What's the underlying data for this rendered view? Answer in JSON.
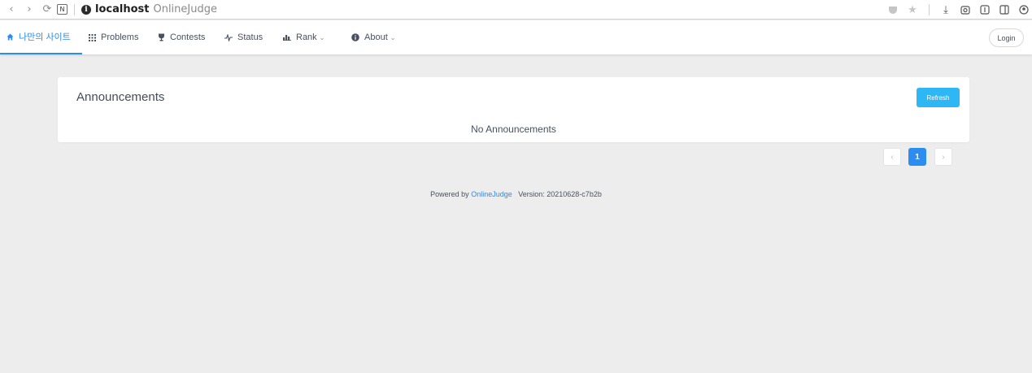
{
  "browser": {
    "n_label": "N",
    "url_host": "localhost",
    "tab_title": "OnlineJudge"
  },
  "nav": {
    "items": [
      {
        "label": "나만의 사이트",
        "icon": "home-icon"
      },
      {
        "label": "Problems",
        "icon": "grid-icon"
      },
      {
        "label": "Contests",
        "icon": "trophy-icon"
      },
      {
        "label": "Status",
        "icon": "pulse-icon"
      },
      {
        "label": "Rank",
        "icon": "bar-chart-icon"
      },
      {
        "label": "About",
        "icon": "info-icon"
      }
    ],
    "login_label": "Login"
  },
  "announcements": {
    "title": "Announcements",
    "refresh_label": "Refresh",
    "empty_text": "No Announcements"
  },
  "pagination": {
    "current_page": "1",
    "prev_symbol": "‹",
    "next_symbol": "›"
  },
  "footer": {
    "powered_by": "Powered by",
    "link_text": "OnlineJudge",
    "version_text": "Version: 20210628-c7b2b"
  },
  "colors": {
    "accent": "#2d8cf0",
    "refresh": "#2db7f5",
    "background": "#ededed"
  }
}
